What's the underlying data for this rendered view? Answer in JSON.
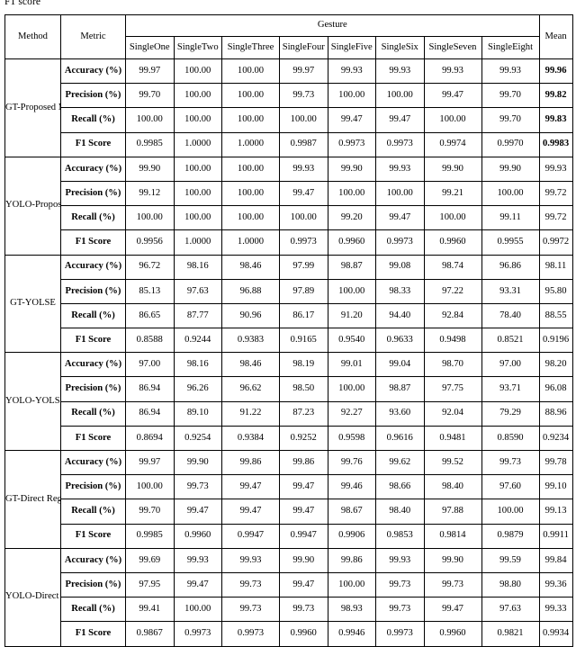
{
  "caption": "F1 score",
  "table": {
    "header": {
      "method_label": "Method",
      "metric_label": "Metric",
      "gesture_group_label": "Gesture",
      "mean_label": "Mean",
      "gesture_columns": [
        "SingleOne",
        "SingleTwo",
        "SingleThree",
        "SingleFour",
        "SingleFive",
        "SingleSix",
        "SingleSeven",
        "SingleEight"
      ]
    },
    "metrics": [
      "Accuracy (%)",
      "Precision (%)",
      "Recall (%)",
      "F1 Score"
    ],
    "blocks": [
      {
        "method": "GT-Proposed Method",
        "bold_mean": true,
        "rows": [
          {
            "metric": "Accuracy (%)",
            "values": [
              "99.97",
              "100.00",
              "100.00",
              "99.97",
              "99.93",
              "99.93",
              "99.93",
              "99.93"
            ],
            "mean": "99.96"
          },
          {
            "metric": "Precision (%)",
            "values": [
              "99.70",
              "100.00",
              "100.00",
              "99.73",
              "100.00",
              "100.00",
              "99.47",
              "99.70"
            ],
            "mean": "99.82"
          },
          {
            "metric": "Recall (%)",
            "values": [
              "100.00",
              "100.00",
              "100.00",
              "100.00",
              "99.47",
              "99.47",
              "100.00",
              "99.70"
            ],
            "mean": "99.83"
          },
          {
            "metric": "F1 Score",
            "values": [
              "0.9985",
              "1.0000",
              "1.0000",
              "0.9987",
              "0.9973",
              "0.9973",
              "0.9974",
              "0.9970"
            ],
            "mean": "0.9983"
          }
        ]
      },
      {
        "method": "YOLO-Proposed Method",
        "bold_mean": false,
        "rows": [
          {
            "metric": "Accuracy (%)",
            "values": [
              "99.90",
              "100.00",
              "100.00",
              "99.93",
              "99.90",
              "99.93",
              "99.90",
              "99.90"
            ],
            "mean": "99.93"
          },
          {
            "metric": "Precision (%)",
            "values": [
              "99.12",
              "100.00",
              "100.00",
              "99.47",
              "100.00",
              "100.00",
              "99.21",
              "100.00"
            ],
            "mean": "99.72"
          },
          {
            "metric": "Recall (%)",
            "values": [
              "100.00",
              "100.00",
              "100.00",
              "100.00",
              "99.20",
              "99.47",
              "100.00",
              "99.11"
            ],
            "mean": "99.72"
          },
          {
            "metric": "F1 Score",
            "values": [
              "0.9956",
              "1.0000",
              "1.0000",
              "0.9973",
              "0.9960",
              "0.9973",
              "0.9960",
              "0.9955"
            ],
            "mean": "0.9972"
          }
        ]
      },
      {
        "method": "GT-YOLSE",
        "bold_mean": false,
        "rows": [
          {
            "metric": "Accuracy (%)",
            "values": [
              "96.72",
              "98.16",
              "98.46",
              "97.99",
              "98.87",
              "99.08",
              "98.74",
              "96.86"
            ],
            "mean": "98.11"
          },
          {
            "metric": "Precision (%)",
            "values": [
              "85.13",
              "97.63",
              "96.88",
              "97.89",
              "100.00",
              "98.33",
              "97.22",
              "93.31"
            ],
            "mean": "95.80"
          },
          {
            "metric": "Recall (%)",
            "values": [
              "86.65",
              "87.77",
              "90.96",
              "86.17",
              "91.20",
              "94.40",
              "92.84",
              "78.40"
            ],
            "mean": "88.55"
          },
          {
            "metric": "F1 Score",
            "values": [
              "0.8588",
              "0.9244",
              "0.9383",
              "0.9165",
              "0.9540",
              "0.9633",
              "0.9498",
              "0.8521"
            ],
            "mean": "0.9196"
          }
        ]
      },
      {
        "method": "YOLO-YOLSE",
        "bold_mean": false,
        "rows": [
          {
            "metric": "Accuracy (%)",
            "values": [
              "97.00",
              "98.16",
              "98.46",
              "98.19",
              "99.01",
              "99.04",
              "98.70",
              "97.00"
            ],
            "mean": "98.20"
          },
          {
            "metric": "Precision (%)",
            "values": [
              "86.94",
              "96.26",
              "96.62",
              "98.50",
              "100.00",
              "98.87",
              "97.75",
              "93.71"
            ],
            "mean": "96.08"
          },
          {
            "metric": "Recall (%)",
            "values": [
              "86.94",
              "89.10",
              "91.22",
              "87.23",
              "92.27",
              "93.60",
              "92.04",
              "79.29"
            ],
            "mean": "88.96"
          },
          {
            "metric": "F1 Score",
            "values": [
              "0.8694",
              "0.9254",
              "0.9384",
              "0.9252",
              "0.9598",
              "0.9616",
              "0.9481",
              "0.8590"
            ],
            "mean": "0.9234"
          }
        ]
      },
      {
        "method": "GT-Direct Regression",
        "bold_mean": false,
        "rows": [
          {
            "metric": "Accuracy (%)",
            "values": [
              "99.97",
              "99.90",
              "99.86",
              "99.86",
              "99.76",
              "99.62",
              "99.52",
              "99.73"
            ],
            "mean": "99.78"
          },
          {
            "metric": "Precision (%)",
            "values": [
              "100.00",
              "99.73",
              "99.47",
              "99.47",
              "99.46",
              "98.66",
              "98.40",
              "97.60"
            ],
            "mean": "99.10"
          },
          {
            "metric": "Recall (%)",
            "values": [
              "99.70",
              "99.47",
              "99.47",
              "99.47",
              "98.67",
              "98.40",
              "97.88",
              "100.00"
            ],
            "mean": "99.13"
          },
          {
            "metric": "F1 Score",
            "values": [
              "0.9985",
              "0.9960",
              "0.9947",
              "0.9947",
              "0.9906",
              "0.9853",
              "0.9814",
              "0.9879"
            ],
            "mean": "0.9911"
          }
        ]
      },
      {
        "method": "YOLO-Direct Regression",
        "bold_mean": false,
        "rows": [
          {
            "metric": "Accuracy (%)",
            "values": [
              "99.69",
              "99.93",
              "99.93",
              "99.90",
              "99.86",
              "99.93",
              "99.90",
              "99.59"
            ],
            "mean": "99.84"
          },
          {
            "metric": "Precision (%)",
            "values": [
              "97.95",
              "99.47",
              "99.73",
              "99.47",
              "100.00",
              "99.73",
              "99.73",
              "98.80"
            ],
            "mean": "99.36"
          },
          {
            "metric": "Recall (%)",
            "values": [
              "99.41",
              "100.00",
              "99.73",
              "99.73",
              "98.93",
              "99.73",
              "99.47",
              "97.63"
            ],
            "mean": "99.33"
          },
          {
            "metric": "F1 Score",
            "values": [
              "0.9867",
              "0.9973",
              "0.9973",
              "0.9960",
              "0.9946",
              "0.9973",
              "0.9960",
              "0.9821"
            ],
            "mean": "0.9934"
          }
        ]
      }
    ]
  }
}
